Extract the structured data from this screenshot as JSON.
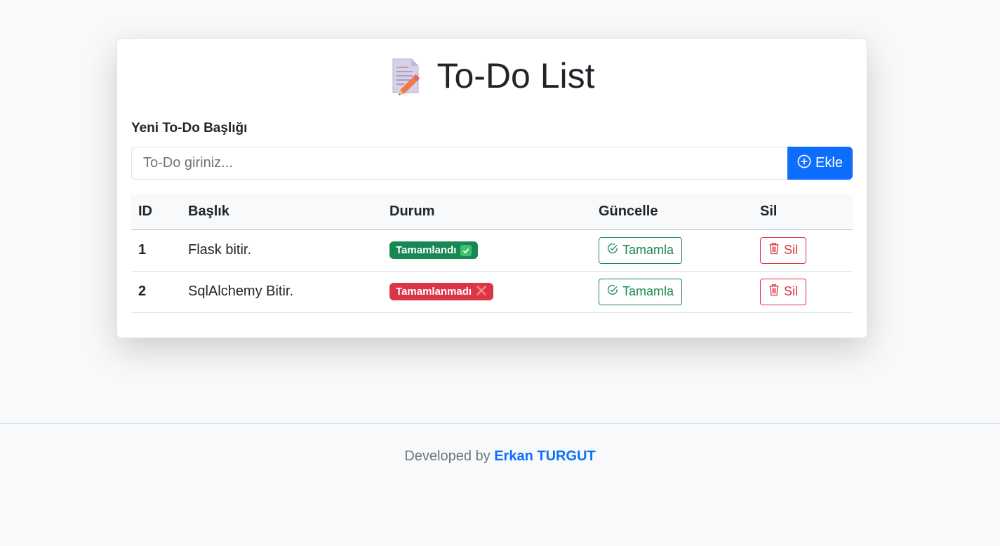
{
  "header": {
    "title": "To-Do List",
    "icon": "memo-icon"
  },
  "form": {
    "label": "Yeni To-Do Başlığı",
    "input_placeholder": "To-Do giriniz...",
    "input_value": "",
    "add_button_label": "Ekle",
    "add_button_icon": "plus-circle-icon"
  },
  "table": {
    "columns": [
      "ID",
      "Başlık",
      "Durum",
      "Güncelle",
      "Sil"
    ],
    "rows": [
      {
        "id": "1",
        "title": "Flask bitir.",
        "status_label": "Tamamlandı",
        "status_icon": "check-mark-icon",
        "status_color": "#198754",
        "update_label": "Tamamla",
        "delete_label": "Sil"
      },
      {
        "id": "2",
        "title": "SqlAlchemy Bitir.",
        "status_label": "Tamamlanmadı",
        "status_icon": "cross-mark-icon",
        "status_color": "#dc3545",
        "update_label": "Tamamla",
        "delete_label": "Sil"
      }
    ]
  },
  "footer": {
    "prefix": "Developed by",
    "author": "Erkan TURGUT"
  },
  "colors": {
    "primary": "#0d6efd",
    "success": "#198754",
    "danger": "#dc3545"
  }
}
